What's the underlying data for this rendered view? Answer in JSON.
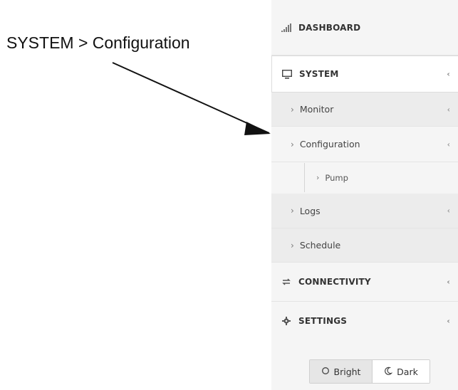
{
  "annotation": {
    "text": "SYSTEM > Configuration"
  },
  "sidebar": {
    "dashboard": {
      "label": "DASHBOARD",
      "icon": "signal-bars-icon"
    },
    "system": {
      "label": "SYSTEM",
      "icon": "monitor-icon",
      "chevron": "‹"
    },
    "monitor": {
      "label": "Monitor",
      "chevron_right": "›",
      "chevron": "‹"
    },
    "configuration": {
      "label": "Configuration",
      "chevron_right": "›",
      "chevron": "‹"
    },
    "pump": {
      "label": "Pump",
      "chevron_right": "›"
    },
    "logs": {
      "label": "Logs",
      "chevron_right": "›",
      "chevron": "‹"
    },
    "schedule": {
      "label": "Schedule",
      "chevron_right": "›"
    },
    "connectivity": {
      "label": "CONNECTIVITY",
      "icon": "connectivity-icon",
      "chevron": "‹"
    },
    "settings": {
      "label": "SETTINGS",
      "icon": "gear-icon",
      "chevron": "‹"
    }
  },
  "theme": {
    "bright_label": "Bright",
    "dark_label": "Dark",
    "selected": "Bright"
  }
}
